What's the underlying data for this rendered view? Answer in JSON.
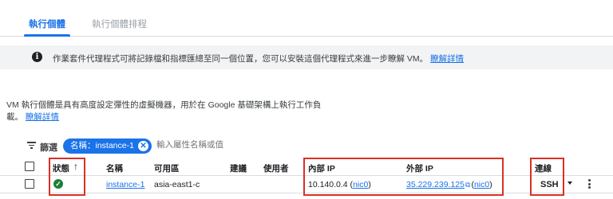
{
  "tabs": {
    "active": "執行個體",
    "inactive": "執行個體排程"
  },
  "banner": {
    "icon": "info-icon",
    "text": "作業套件代理程式可將記錄檔和指標匯總至同一個位置，您可以安裝這個代理程式來進一步瞭解 VM。",
    "link": "瞭解詳情"
  },
  "description": {
    "text": "VM 執行個體是具有高度設定彈性的虛擬機器，用於在 Google 基礎架構上執行工作負載。",
    "link": "瞭解詳情"
  },
  "filter": {
    "label": "篩選",
    "chip": "名稱：instance-1",
    "placeholder": "輸入屬性名稱或值"
  },
  "table": {
    "headers": {
      "status": "狀態",
      "name": "名稱",
      "zone": "可用區",
      "recommendation": "建議",
      "in_use_by": "使用者",
      "internal_ip": "內部 IP",
      "external_ip": "外部 IP",
      "connect": "連線"
    },
    "sort_arrow": "↑",
    "rows": [
      {
        "status": "running",
        "name": "instance-1",
        "zone": "asia-east1-c",
        "internal_ip": "10.140.0.4",
        "internal_nic": "nic0",
        "external_ip": "35.229.239.125",
        "external_nic": "nic0",
        "connect": "SSH"
      }
    ]
  },
  "colors": {
    "accent": "#1a73e8",
    "status_ok": "#188038",
    "highlight": "#d93025"
  }
}
